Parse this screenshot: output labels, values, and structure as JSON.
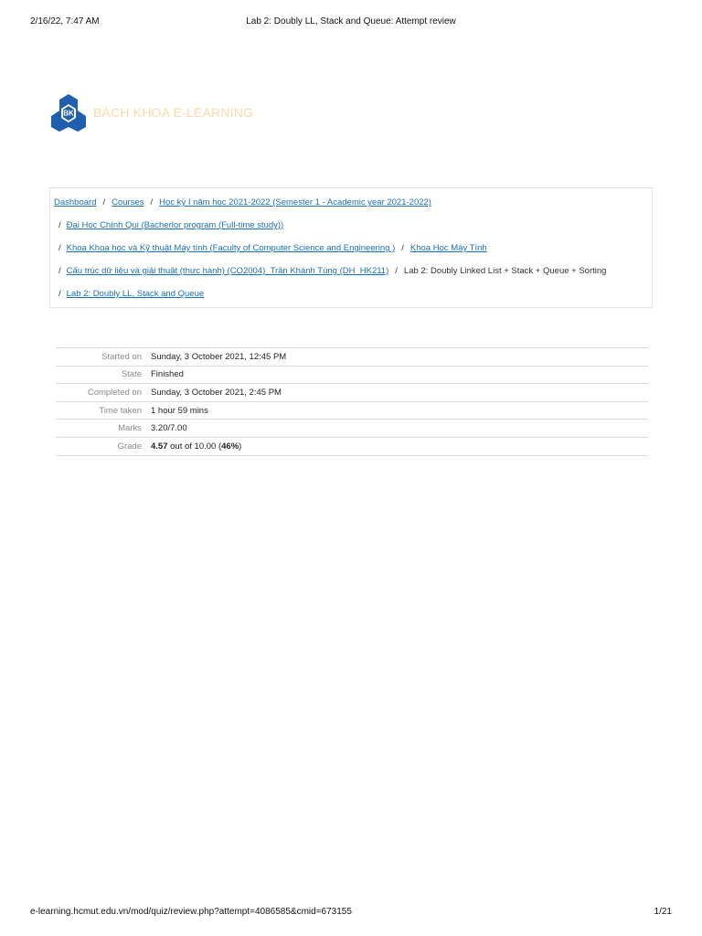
{
  "print_header": {
    "date": "2/16/22, 7:47 AM",
    "title": "Lab 2: Doubly LL, Stack and Queue: Attempt review"
  },
  "logo": {
    "badge_text": "BK",
    "brand": "BÁCH KHOA E-LEARNING",
    "colors": {
      "primary": "#1f5fae",
      "brand_text": "#fcd9a8"
    }
  },
  "breadcrumb": {
    "separator": "/",
    "items": [
      {
        "label": "Dashboard",
        "link": true
      },
      {
        "label": "Courses",
        "link": true
      },
      {
        "label": "Học kỳ I năm học 2021-2022 (Semester 1 - Academic year 2021-2022)",
        "link": true
      },
      {
        "label": "Đại Học Chính Qui (Bacherlor program (Full-time study))",
        "link": true
      },
      {
        "label": "Khoa Khoa học và Kỹ thuật Máy tính (Faculty of Computer Science and Engineering )",
        "link": true
      },
      {
        "label": "Khoa Học Máy Tính",
        "link": true
      },
      {
        "label": "Cấu trúc dữ liệu và giải thuật (thực hành) (CO2004)_Trần Khánh Tùng (DH_HK211)",
        "link": true
      },
      {
        "label": "Lab 2: Doubly Linked List + Stack + Queue + Sorting",
        "link": false
      },
      {
        "label": "Lab 2: Doubly LL, Stack and Queue",
        "link": true
      }
    ]
  },
  "summary": {
    "started_on": {
      "label": "Started on",
      "value": "Sunday, 3 October 2021, 12:45 PM"
    },
    "state": {
      "label": "State",
      "value": "Finished"
    },
    "completed_on": {
      "label": "Completed on",
      "value": "Sunday, 3 October 2021, 2:45 PM"
    },
    "time_taken": {
      "label": "Time taken",
      "value": "1 hour 59 mins"
    },
    "marks": {
      "label": "Marks",
      "value": "3.20/7.00"
    },
    "grade": {
      "label": "Grade",
      "score": "4.57",
      "middle": " out of 10.00 (",
      "percent": "46%",
      "end": ")"
    }
  },
  "print_footer": {
    "url": "e-learning.hcmut.edu.vn/mod/quiz/review.php?attempt=4086585&cmid=673155",
    "page": "1/21"
  }
}
